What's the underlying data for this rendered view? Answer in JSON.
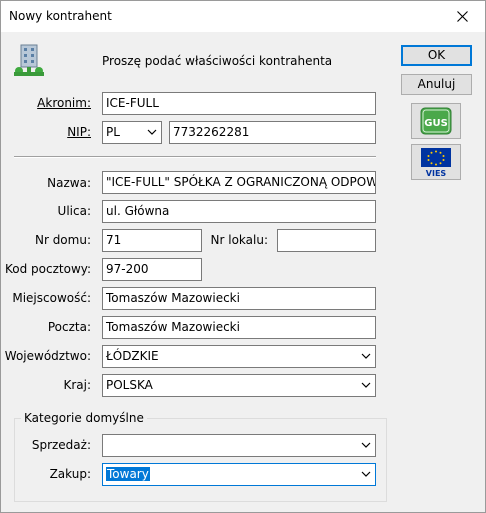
{
  "window": {
    "title": "Nowy kontrahent"
  },
  "header": {
    "prompt": "Proszę podać właściwości kontrahenta"
  },
  "buttons": {
    "ok": "OK",
    "cancel": "Anuluj",
    "gus_label": "GUS",
    "vies_label": "VIES"
  },
  "fields": {
    "akronim": {
      "label": "Akronim:",
      "value": "ICE-FULL"
    },
    "nip": {
      "label": "NIP:",
      "country": "PL",
      "value": "7732262281"
    },
    "nazwa": {
      "label": "Nazwa:",
      "value": "\"ICE-FULL\" SPÓŁKA Z OGRANICZONĄ ODPOWIEDZIALNOŚCIĄ"
    },
    "ulica": {
      "label": "Ulica:",
      "value": "ul. Główna"
    },
    "nr_domu": {
      "label": "Nr domu:",
      "value": "71"
    },
    "nr_lokalu": {
      "label": "Nr lokalu:",
      "value": ""
    },
    "kod_pocztowy": {
      "label": "Kod pocztowy:",
      "value": "97-200"
    },
    "miejscowosc": {
      "label": "Miejscowość:",
      "value": "Tomaszów Mazowiecki"
    },
    "poczta": {
      "label": "Poczta:",
      "value": "Tomaszów Mazowiecki"
    },
    "wojewodztwo": {
      "label": "Województwo:",
      "value": "ŁÓDZKIE"
    },
    "kraj": {
      "label": "Kraj:",
      "value": "POLSKA"
    }
  },
  "categories": {
    "title": "Kategorie domyślne",
    "sprzedaz": {
      "label": "Sprzedaż:",
      "value": ""
    },
    "zakup": {
      "label": "Zakup:",
      "value": "Towary"
    }
  },
  "icons": {
    "header_icon": "contractor-building-icon",
    "close": "close-icon",
    "dropdown": "chevron-down-icon",
    "gus": "gus-logo-icon",
    "vies": "vies-eu-flag-icon"
  },
  "colors": {
    "accent": "#0078d7",
    "gus_green": "#2e8b3a",
    "eu_blue": "#0033a0",
    "eu_gold": "#ffcc00"
  }
}
